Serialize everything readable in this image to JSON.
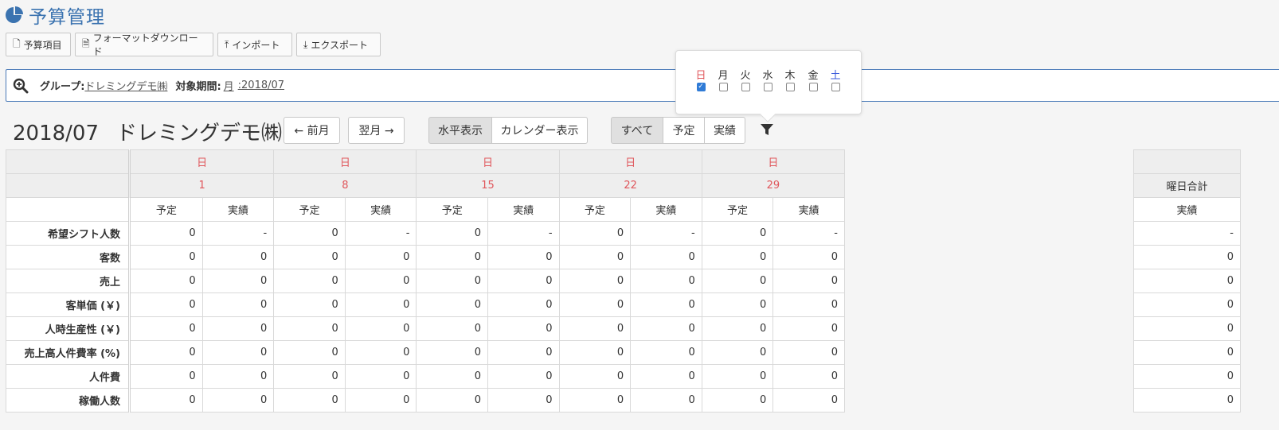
{
  "page": {
    "title": "予算管理"
  },
  "toolbar": {
    "budget_items": "予算項目",
    "format_download": "フォーマットダウンロード",
    "import": "インポート",
    "export": "エクスポート"
  },
  "search": {
    "group_label": "グループ:",
    "group_value": "ドレミングデモ㈱",
    "period_label": "対象期間:",
    "period_unit": "月",
    "period_value": ":2018/07"
  },
  "heading": {
    "month": "2018/07",
    "company": "ドレミングデモ㈱"
  },
  "nav": {
    "prev": "← 前月",
    "next": "翌月 →"
  },
  "view_toggle": {
    "horizontal": "水平表示",
    "calendar": "カレンダー表示",
    "active": "horizontal"
  },
  "type_filter": {
    "all": "すべて",
    "planned": "予定",
    "actual": "実績",
    "active": "all"
  },
  "weekday_filter": {
    "days": [
      {
        "label": "日",
        "checked": true,
        "color": "#e0565b"
      },
      {
        "label": "月",
        "checked": false,
        "color": "#333333"
      },
      {
        "label": "火",
        "checked": false,
        "color": "#333333"
      },
      {
        "label": "水",
        "checked": false,
        "color": "#333333"
      },
      {
        "label": "木",
        "checked": false,
        "color": "#333333"
      },
      {
        "label": "金",
        "checked": false,
        "color": "#333333"
      },
      {
        "label": "土",
        "checked": false,
        "color": "#3b5bdb"
      }
    ]
  },
  "table": {
    "columns": [
      {
        "weekday": "日",
        "date": "1"
      },
      {
        "weekday": "日",
        "date": "8"
      },
      {
        "weekday": "日",
        "date": "15"
      },
      {
        "weekday": "日",
        "date": "22"
      },
      {
        "weekday": "日",
        "date": "29"
      }
    ],
    "sub_planned": "予定",
    "sub_actual": "実績",
    "rows": [
      {
        "label": "希望シフト人数",
        "values": [
          "0",
          "-",
          "0",
          "-",
          "0",
          "-",
          "0",
          "-",
          "0",
          "-"
        ]
      },
      {
        "label": "客数",
        "values": [
          "0",
          "0",
          "0",
          "0",
          "0",
          "0",
          "0",
          "0",
          "0",
          "0"
        ]
      },
      {
        "label": "売上",
        "values": [
          "0",
          "0",
          "0",
          "0",
          "0",
          "0",
          "0",
          "0",
          "0",
          "0"
        ]
      },
      {
        "label": "客単価 (￥)",
        "values": [
          "0",
          "0",
          "0",
          "0",
          "0",
          "0",
          "0",
          "0",
          "0",
          "0"
        ]
      },
      {
        "label": "人時生産性 (￥)",
        "values": [
          "0",
          "0",
          "0",
          "0",
          "0",
          "0",
          "0",
          "0",
          "0",
          "0"
        ]
      },
      {
        "label": "売上高人件費率 (%)",
        "values": [
          "0",
          "0",
          "0",
          "0",
          "0",
          "0",
          "0",
          "0",
          "0",
          "0"
        ]
      },
      {
        "label": "人件費",
        "values": [
          "0",
          "0",
          "0",
          "0",
          "0",
          "0",
          "0",
          "0",
          "0",
          "0"
        ]
      },
      {
        "label": "稼働人数",
        "values": [
          "0",
          "0",
          "0",
          "0",
          "0",
          "0",
          "0",
          "0",
          "0",
          "0"
        ]
      }
    ]
  },
  "summary": {
    "header": "曜日合計",
    "sub": "実績",
    "values": [
      "-",
      "0",
      "0",
      "0",
      "0",
      "0",
      "0",
      "0"
    ]
  }
}
